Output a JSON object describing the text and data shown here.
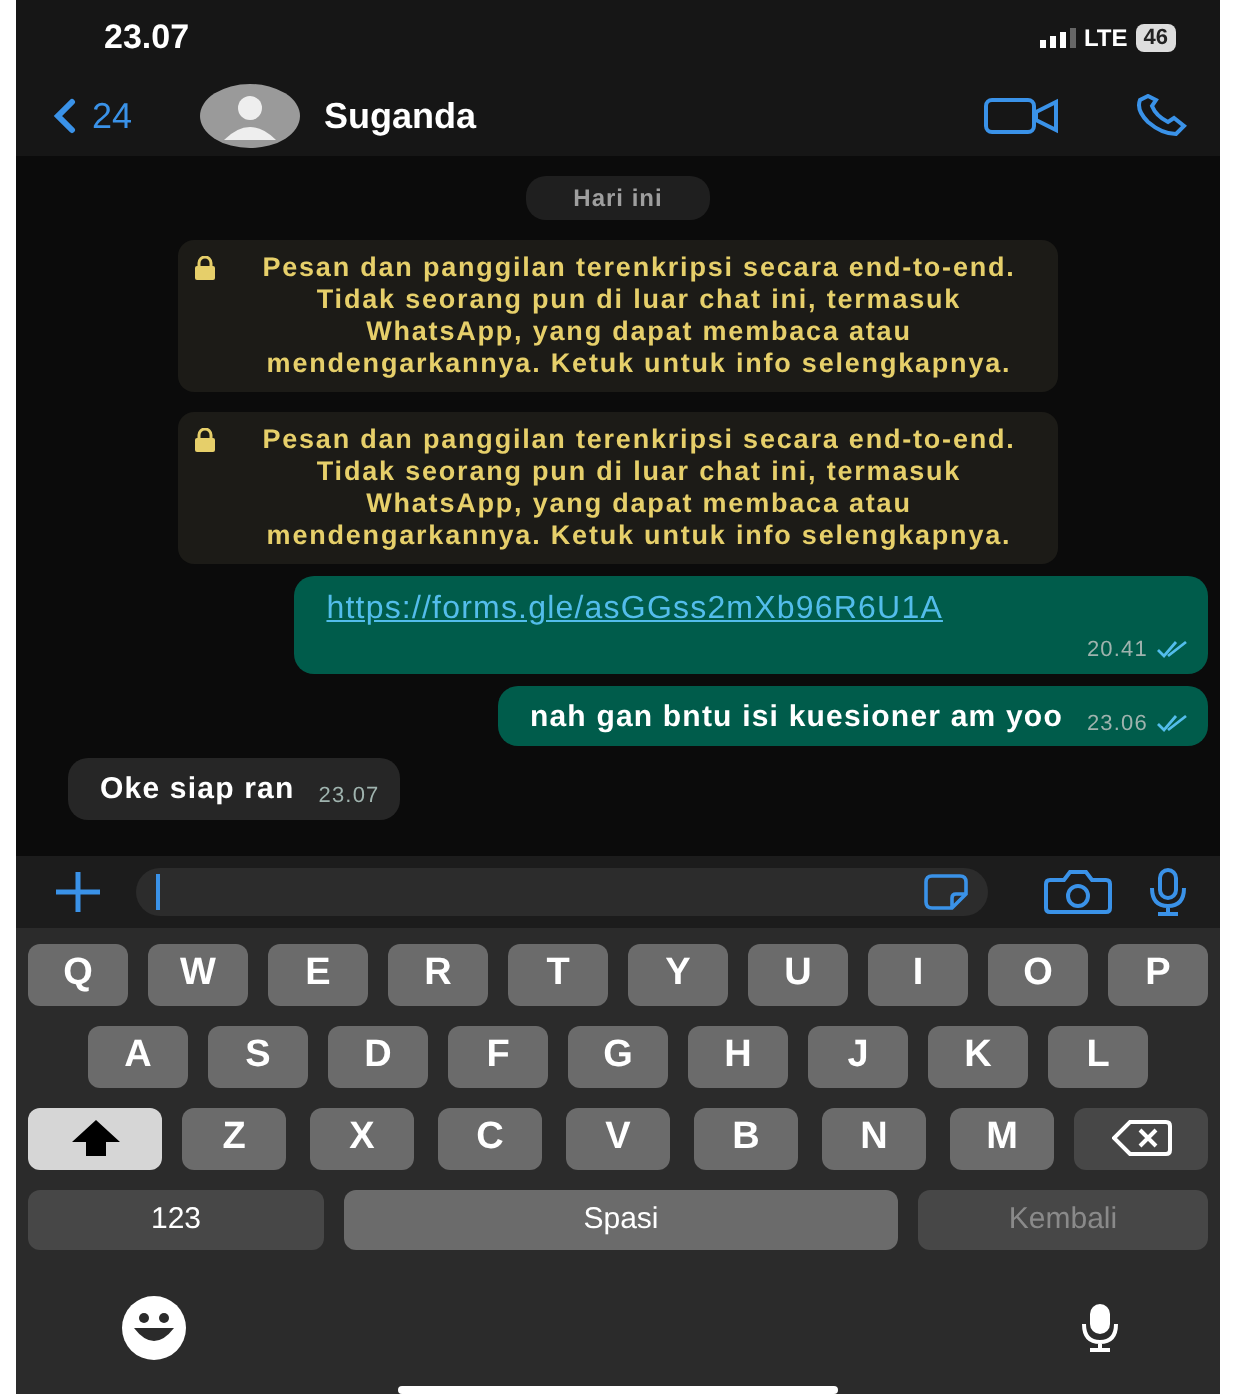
{
  "status_bar": {
    "time": "23.07",
    "network": "LTE",
    "battery": "46"
  },
  "header": {
    "back_count": "24",
    "contact_name": "Suganda"
  },
  "messages": [
    {
      "kind": "date",
      "text": "Hari ini"
    },
    {
      "kind": "notice",
      "text": "Pesan dan panggilan terenkripsi secara end-to-end. Tidak seorang pun di luar chat ini, termasuk WhatsApp, yang dapat membaca atau mendengarkannya. Ketuk untuk info selengkapnya."
    },
    {
      "kind": "notice",
      "text": "Pesan dan panggilan terenkripsi secara end-to-end. Tidak seorang pun di luar chat ini, termasuk WhatsApp, yang dapat membaca atau mendengarkannya. Ketuk untuk info selengkapnya."
    },
    {
      "kind": "outgoing",
      "text": "https://forms.gle/asGGss2mXb96R6U1A",
      "link": true,
      "time": "20.41",
      "read": true
    },
    {
      "kind": "outgoing",
      "text": "nah gan bntu isi kuesioner am yoo",
      "link": false,
      "time": "23.06",
      "read": true
    },
    {
      "kind": "incoming",
      "text": "Oke siap ran",
      "time": "23.07"
    }
  ],
  "keyboard": {
    "row_1": [
      {
        "kind": "letter",
        "label": "Q"
      },
      {
        "kind": "letter",
        "label": "W"
      },
      {
        "kind": "letter",
        "label": "E"
      },
      {
        "kind": "letter",
        "label": "R"
      },
      {
        "kind": "letter",
        "label": "T"
      },
      {
        "kind": "letter",
        "label": "Y"
      },
      {
        "kind": "letter",
        "label": "U"
      },
      {
        "kind": "letter",
        "label": "I"
      },
      {
        "kind": "letter",
        "label": "O"
      },
      {
        "kind": "letter",
        "label": "P"
      }
    ],
    "row_2": [
      {
        "kind": "letter",
        "label": "A"
      },
      {
        "kind": "letter",
        "label": "S"
      },
      {
        "kind": "letter",
        "label": "D"
      },
      {
        "kind": "letter",
        "label": "F"
      },
      {
        "kind": "letter",
        "label": "G"
      },
      {
        "kind": "letter",
        "label": "H"
      },
      {
        "kind": "letter",
        "label": "J"
      },
      {
        "kind": "letter",
        "label": "K"
      },
      {
        "kind": "letter",
        "label": "L"
      }
    ],
    "row_3": [
      {
        "kind": "shift",
        "on": true
      },
      {
        "kind": "letter",
        "label": "Z"
      },
      {
        "kind": "letter",
        "label": "X"
      },
      {
        "kind": "letter",
        "label": "C"
      },
      {
        "kind": "letter",
        "label": "V"
      },
      {
        "kind": "letter",
        "label": "B"
      },
      {
        "kind": "letter",
        "label": "N"
      },
      {
        "kind": "letter",
        "label": "M"
      },
      {
        "kind": "backspace"
      }
    ],
    "row_4": [
      {
        "kind": "numbers",
        "label": "123"
      },
      {
        "kind": "space",
        "label": "Spasi"
      },
      {
        "kind": "return",
        "label": "Kembali",
        "disabled": true
      }
    ]
  }
}
